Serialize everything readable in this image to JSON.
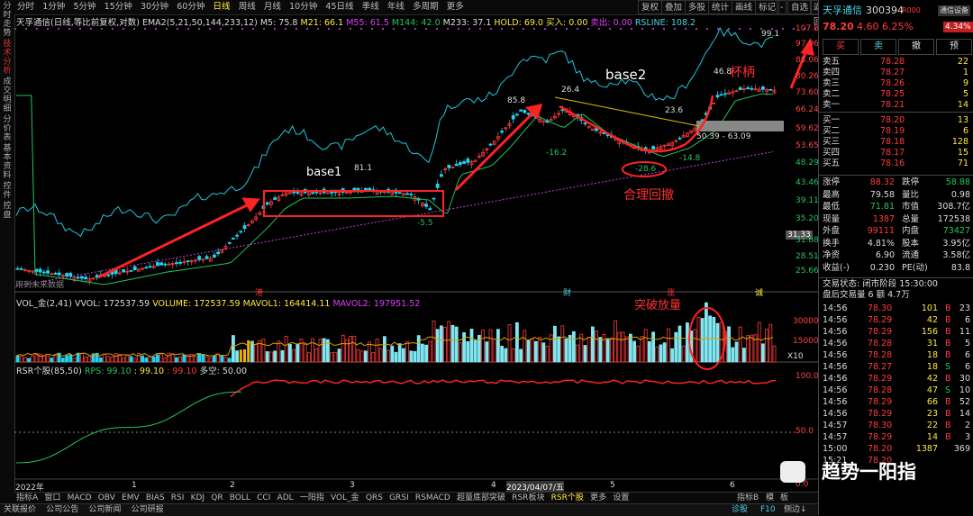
{
  "left_tabs": [
    "分时走势",
    "技术分析",
    "成交明细",
    "分价表",
    "基本资料",
    "控件",
    "控盘"
  ],
  "topbar": {
    "items": [
      "分时",
      "1分钟",
      "5分钟",
      "15分钟",
      "30分钟",
      "60分钟",
      "日线",
      "周线",
      "月线",
      "10分钟",
      "45日线",
      "季线",
      "年线",
      "多周期",
      "更多"
    ],
    "active": "日线",
    "right": [
      "复权",
      "叠加",
      "多股",
      "统计",
      "画线",
      "标记",
      "-",
      "自选",
      "返回"
    ]
  },
  "info": {
    "stock": "天孚通信(日线,等比前复权,对数)",
    "ema": "EMA2(5,21,50,144,233,12)",
    "ma5": "M5: 75.8",
    "m21": "M21: 66.1",
    "m55": "M55: 61.5",
    "m144": "M144: 42.0",
    "m233": "M233: 37.1",
    "hold": "HOLD: 69.0",
    "buy": "买入: 0.00",
    "sell": "卖出: 0.00",
    "rsline": "RSLINE: 108.2"
  },
  "price_axis": [
    "107.8",
    "97.96",
    "88.06",
    "80.26",
    "73.60",
    "66.24",
    "59.62",
    "53.65",
    "48.29",
    "43.46",
    "39.11",
    "35.20",
    "31.68",
    "28.51",
    "25.66"
  ],
  "price_axis_highlight": "31.33",
  "annotations": {
    "base1": "base1",
    "base2": "base2",
    "handle": "杯柄",
    "pullback": "合理回撤",
    "breakout": "突破放量",
    "v811": "81.1",
    "v858": "85.8",
    "v264": "26.4",
    "v236": "23.6",
    "v468": "46.8",
    "v991": "99.1",
    "vm162": "-16.2",
    "vm286": "-28.6",
    "vm148": "-14.8",
    "vm5": "-5.5",
    "range": "50.39 - 63.09",
    "nodata": "用到未来数据",
    "flags": [
      "港",
      "财",
      "涨",
      "诚"
    ]
  },
  "vol": {
    "title": "VOL_金(2,41)",
    "vvol": "VVOL: 172537.59",
    "volume": "VOLUME: 172537.59",
    "mavol1": "MAVOL1: 164414.11",
    "mavol2": "MAVOL2: 197951.52",
    "axis": [
      "30000",
      "15000",
      "X10"
    ]
  },
  "rsr": {
    "title": "RSR个股(85,50)",
    "rps": "RPS: 99.10",
    "v1": ": 99.10",
    "v2": ": 99.10",
    "ds": "多空: 50.00",
    "axis": [
      "100.0",
      "50.0",
      "0.0"
    ]
  },
  "xaxis": [
    "2022年",
    "1",
    "2",
    "3",
    "4",
    "2023/04/07/五",
    "5",
    "6"
  ],
  "indicator_bar": [
    "指标A",
    "窗口",
    "MACD",
    "OBV",
    "EMV",
    "BIAS",
    "RSI",
    "KDJ",
    "QR",
    "BOLL",
    "CCI",
    "ADL",
    "一阳指",
    "VOL_金",
    "QRS",
    "GRSI",
    "RSMACD",
    "超量底部突破",
    "RSR板块",
    "RSR个股",
    "更多",
    "设置"
  ],
  "indicator_active": "RSR个股",
  "indicator_right": [
    "指标B",
    "模",
    "板"
  ],
  "status_bar": [
    "关联报价",
    "公司公告",
    "公司新闻",
    "公司研报"
  ],
  "status_right": [
    "诊股",
    "F10",
    "侧边↓"
  ],
  "quote": {
    "name": "天孚通信",
    "code": "300394",
    "tag": "R000",
    "settings": "通信设备",
    "price": "78.20",
    "change": "4.60",
    "pct": "6.25%",
    "pct_badge": "4.34%",
    "buttons": [
      "买",
      "卖",
      "撤",
      "预"
    ],
    "asks": [
      {
        "label": "卖五",
        "price": "78.28",
        "vol": "22"
      },
      {
        "label": "卖四",
        "price": "78.27",
        "vol": "1"
      },
      {
        "label": "卖三",
        "price": "78.26",
        "vol": "9"
      },
      {
        "label": "卖二",
        "price": "78.25",
        "vol": "5"
      },
      {
        "label": "卖一",
        "price": "78.21",
        "vol": "14"
      }
    ],
    "bids": [
      {
        "label": "买一",
        "price": "78.20",
        "vol": "13"
      },
      {
        "label": "买二",
        "price": "78.19",
        "vol": "6"
      },
      {
        "label": "买三",
        "price": "78.18",
        "vol": "128"
      },
      {
        "label": "买四",
        "price": "78.17",
        "vol": "15"
      },
      {
        "label": "买五",
        "price": "78.16",
        "vol": "71"
      }
    ],
    "stats": [
      {
        "k1": "涨停",
        "v1": "88.32",
        "k2": "跌停",
        "v2": "58.88"
      },
      {
        "k1": "最高",
        "v1": "79.58",
        "k2": "量比",
        "v2": "0.98"
      },
      {
        "k1": "最低",
        "v1": "71.81",
        "k2": "市值",
        "v2": "308.7亿"
      },
      {
        "k1": "现量",
        "v1": "1387",
        "k2": "总量",
        "v2": "172538"
      },
      {
        "k1": "外盘",
        "v1": "99111",
        "k2": "内盘",
        "v2": "73427"
      },
      {
        "k1": "换手",
        "v1": "4.81%",
        "k2": "股本",
        "v2": "3.95亿"
      },
      {
        "k1": "净资",
        "v1": "6.90",
        "k2": "流通",
        "v2": "3.58亿"
      },
      {
        "k1": "收益(-)",
        "v1": "0.230",
        "k2": "PE(动)",
        "v2": "83.8"
      }
    ],
    "trade_status": "交易状态: 闭市阶段 15:30:00",
    "after_hours": "盘后交易量 6 额 4.7万",
    "ticks": [
      {
        "t": "14:56",
        "p": "78.30",
        "v": "101",
        "s": "B",
        "x": "23"
      },
      {
        "t": "14:56",
        "p": "78.29",
        "v": "42",
        "s": "B",
        "x": "6"
      },
      {
        "t": "14:56",
        "p": "78.29",
        "v": "156",
        "s": "B",
        "x": "11"
      },
      {
        "t": "14:56",
        "p": "78.28",
        "v": "31",
        "s": "B",
        "x": "5"
      },
      {
        "t": "14:56",
        "p": "78.28",
        "v": "18",
        "s": "B",
        "x": "6"
      },
      {
        "t": "14:56",
        "p": "78.27",
        "v": "18",
        "s": "S",
        "x": "6"
      },
      {
        "t": "14:56",
        "p": "78.29",
        "v": "42",
        "s": "B",
        "x": "30"
      },
      {
        "t": "14:56",
        "p": "78.28",
        "v": "47",
        "s": "S",
        "x": "10"
      },
      {
        "t": "14:56",
        "p": "78.29",
        "v": "66",
        "s": "B",
        "x": "52"
      },
      {
        "t": "14:56",
        "p": "78.29",
        "v": "23",
        "s": "B",
        "x": "14"
      },
      {
        "t": "14:57",
        "p": "78.30",
        "v": "22",
        "s": "B",
        "x": "2"
      },
      {
        "t": "14:57",
        "p": "78.29",
        "v": "14",
        "s": "B",
        "x": "3"
      },
      {
        "t": "15:00",
        "p": "78.20",
        "v": "1387",
        "s": "",
        "x": "369"
      },
      {
        "t": "15:21",
        "p": "78.20",
        "v": "",
        "s": "",
        "x": ""
      }
    ]
  },
  "watermark": "趋势一阳指",
  "colors": {
    "up": "#ff3b3b",
    "down": "#22c55e",
    "accent": "#ffeb3b",
    "cyan": "#4dd0e1",
    "arrow": "#ff2222"
  }
}
